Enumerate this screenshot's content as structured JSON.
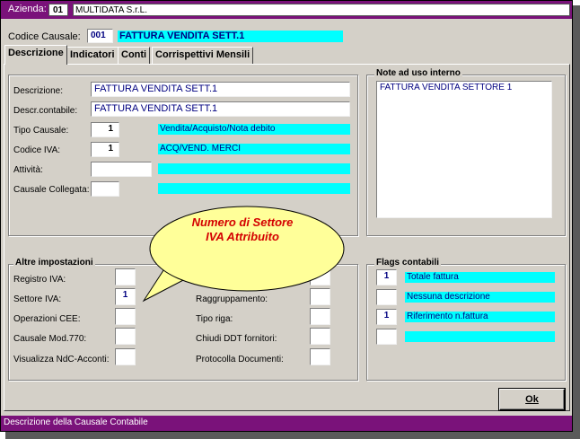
{
  "header": {
    "company_label": "Azienda:",
    "company_code": "01",
    "company_name": "MULTIDATA S.r.L."
  },
  "causale": {
    "label": "Codice Causale:",
    "code": "001",
    "description": "FATTURA VENDITA SETT.1"
  },
  "tabs": [
    {
      "label": "Descrizione"
    },
    {
      "label": "Indicatori"
    },
    {
      "label": "Conti"
    },
    {
      "label": "Corrispettivi Mensili"
    }
  ],
  "form": {
    "descrizione": {
      "label": "Descrizione:",
      "value": "FATTURA VENDITA SETT.1"
    },
    "descr_contabile": {
      "label": "Descr.contabile:",
      "value": "FATTURA VENDITA SETT.1"
    },
    "tipo_causale": {
      "label": "Tipo Causale:",
      "value": "1",
      "desc": "Vendita/Acquisto/Nota debito"
    },
    "codice_iva": {
      "label": "Codice IVA:",
      "value": "1",
      "desc": "ACQ/VEND. MERCI"
    },
    "attivita": {
      "label": "Attività:",
      "value": "",
      "desc": ""
    },
    "causale_collegata": {
      "label": "Causale Collegata:",
      "value": "",
      "desc": ""
    }
  },
  "notes": {
    "title": "Note ad uso interno",
    "text": "FATTURA VENDITA SETTORE 1"
  },
  "altre": {
    "title": "Altre impostazioni",
    "registro_iva": {
      "label": "Registro IVA:",
      "value": ""
    },
    "settore_iva": {
      "label": "Settore IVA:",
      "value": "1"
    },
    "operazioni_cee": {
      "label": "Operazioni CEE:",
      "value": ""
    },
    "causale_770": {
      "label": "Causale Mod.770:",
      "value": ""
    },
    "visualizza_ndc": {
      "label": "Visualizza NdC-Acconti:",
      "value": ""
    },
    "raggruppamento": {
      "label": "Raggruppamento:",
      "value": ""
    },
    "tipo_riga": {
      "label": "Tipo riga:",
      "value": ""
    },
    "chiudi_ddt": {
      "label": "Chiudi DDT fornitori:",
      "value": ""
    },
    "protocolla": {
      "label": "Protocolla Documenti:",
      "value": ""
    },
    "hidden_field": {
      "value": ""
    }
  },
  "flags": {
    "title": "Flags contabili",
    "items": [
      {
        "value": "1",
        "label": "Totale fattura"
      },
      {
        "value": "",
        "label": "Nessuna descrizione"
      },
      {
        "value": "1",
        "label": "Riferimento n.fattura"
      },
      {
        "value": "",
        "label": ""
      }
    ]
  },
  "callout": {
    "line1": "Numero di Settore",
    "line2": "IVA Attribuito"
  },
  "ok_label": "Ok",
  "status": "Descrizione della Causale Contabile",
  "colors": {
    "titlebar": "#7a127a",
    "accent_field": "#00ffff",
    "balloon": "#ffff99",
    "callout_text": "#d40000"
  }
}
